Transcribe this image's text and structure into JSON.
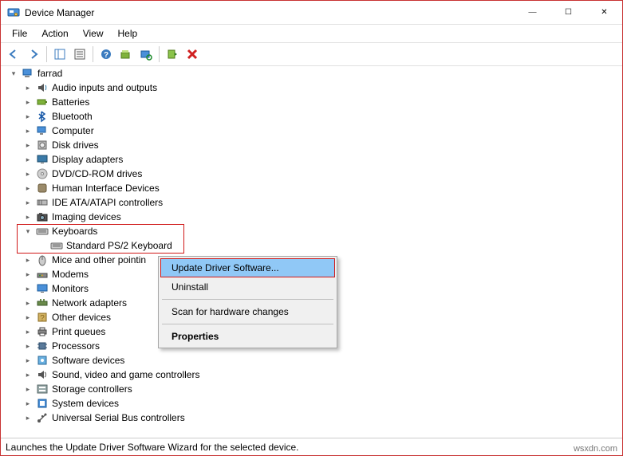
{
  "window": {
    "title": "Device Manager",
    "controls": {
      "min": "—",
      "max": "☐",
      "close": "✕"
    }
  },
  "menu": {
    "items": [
      "File",
      "Action",
      "View",
      "Help"
    ]
  },
  "toolbar": {
    "tips": [
      "Back",
      "Forward",
      "Show/Hide Console Tree",
      "Properties",
      "Help",
      "Update Driver Software",
      "Uninstall",
      "Scan for hardware changes",
      "Disable"
    ]
  },
  "tree": {
    "root": "farrad",
    "items": [
      {
        "label": "Audio inputs and outputs",
        "icon": "audio"
      },
      {
        "label": "Batteries",
        "icon": "battery"
      },
      {
        "label": "Bluetooth",
        "icon": "bluetooth"
      },
      {
        "label": "Computer",
        "icon": "computer"
      },
      {
        "label": "Disk drives",
        "icon": "disk"
      },
      {
        "label": "Display adapters",
        "icon": "display"
      },
      {
        "label": "DVD/CD-ROM drives",
        "icon": "dvd"
      },
      {
        "label": "Human Interface Devices",
        "icon": "hid"
      },
      {
        "label": "IDE ATA/ATAPI controllers",
        "icon": "ide"
      },
      {
        "label": "Imaging devices",
        "icon": "imaging"
      },
      {
        "label": "Keyboards",
        "icon": "keyboard",
        "expanded": true,
        "children": [
          {
            "label": "Standard PS/2 Keyboard",
            "icon": "keyboard"
          }
        ]
      },
      {
        "label": "Mice and other pointin",
        "icon": "mouse"
      },
      {
        "label": "Modems",
        "icon": "modem"
      },
      {
        "label": "Monitors",
        "icon": "monitor"
      },
      {
        "label": "Network adapters",
        "icon": "network"
      },
      {
        "label": "Other devices",
        "icon": "other"
      },
      {
        "label": "Print queues",
        "icon": "printer"
      },
      {
        "label": "Processors",
        "icon": "cpu"
      },
      {
        "label": "Software devices",
        "icon": "software"
      },
      {
        "label": "Sound, video and game controllers",
        "icon": "sound"
      },
      {
        "label": "Storage controllers",
        "icon": "storage"
      },
      {
        "label": "System devices",
        "icon": "system"
      },
      {
        "label": "Universal Serial Bus controllers",
        "icon": "usb"
      }
    ]
  },
  "context_menu": {
    "items": [
      {
        "label": "Update Driver Software...",
        "highlighted": true
      },
      {
        "label": "Uninstall"
      },
      {
        "sep": true
      },
      {
        "label": "Scan for hardware changes"
      },
      {
        "sep": true
      },
      {
        "label": "Properties",
        "bold": true
      }
    ]
  },
  "statusbar": {
    "text": "Launches the Update Driver Software Wizard for the selected device."
  },
  "watermark": "wsxdn.com"
}
